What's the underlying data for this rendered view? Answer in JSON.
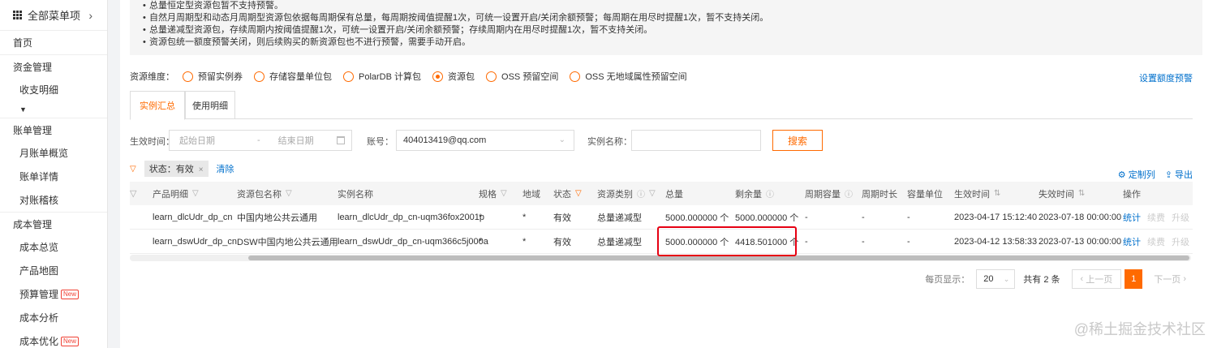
{
  "sidebar": {
    "header": "全部菜单项",
    "items": [
      {
        "label": "首页",
        "type": "top"
      },
      {
        "label": "资金管理",
        "type": "group"
      },
      {
        "label": "收支明细",
        "type": "sub"
      },
      {
        "label": "账单管理",
        "type": "group"
      },
      {
        "label": "月账单概览",
        "type": "sub"
      },
      {
        "label": "账单详情",
        "type": "sub"
      },
      {
        "label": "对账稽核",
        "type": "sub"
      },
      {
        "label": "成本管理",
        "type": "group"
      },
      {
        "label": "成本总览",
        "type": "sub"
      },
      {
        "label": "产品地图",
        "type": "sub"
      },
      {
        "label": "预算管理",
        "type": "sub",
        "badge": "New"
      },
      {
        "label": "成本分析",
        "type": "sub"
      },
      {
        "label": "成本优化",
        "type": "sub",
        "badge": "New"
      }
    ]
  },
  "notice": [
    "总量恒定型资源包暂不支持预警。",
    "自然月周期型和动态月周期型资源包依据每周期保有总量，每周期按阈值提醒1次，可统一设置开启/关闭余额预警；每周期在用尽时提醒1次，暂不支持关闭。",
    "总量递减型资源包，存续周期内按阈值提醒1次，可统一设置开启/关闭余额预警；存续周期内在用尽时提醒1次，暂不支持关闭。",
    "资源包统一额度预警关闭，则后续购买的新资源包也不进行预警，需要手动开启。"
  ],
  "dimension": {
    "label": "资源维度：",
    "options": [
      "预留实例券",
      "存储容量单位包",
      "PolarDB 计算包",
      "资源包",
      "OSS 预留空间",
      "OSS 无地域属性预留空间"
    ],
    "selected": "资源包",
    "right_link": "设置额度预警"
  },
  "tabs": [
    "实例汇总",
    "使用明细"
  ],
  "active_tab": "实例汇总",
  "filters": {
    "effective_label": "生效时间：",
    "start_placeholder": "起始日期",
    "date_sep": "-",
    "end_placeholder": "结束日期",
    "account_label": "账号：",
    "account_value": "404013419@qq.com",
    "instance_label": "实例名称：",
    "instance_value": "",
    "search_label": "搜索"
  },
  "tag_filter": {
    "chip": "状态：有效",
    "clear": "清除",
    "custom_cols": "定制列",
    "export": "导出"
  },
  "table": {
    "columns": [
      "产品明细",
      "资源包名称",
      "实例名称",
      "规格",
      "地域",
      "状态",
      "资源类别",
      "总量",
      "剩余量",
      "周期容量",
      "周期时长",
      "容量单位",
      "生效时间",
      "失效时间",
      "操作"
    ],
    "rows": [
      {
        "product": "learn_dlcUdr_dp_cn",
        "pkg": "中国内地公共云通用",
        "instance": "learn_dlcUdr_dp_cn-uqm36fox2001p",
        "spec": "*",
        "region": "*",
        "status": "有效",
        "category": "总量递减型",
        "total": "5000.000000 个",
        "remain": "5000.000000 个",
        "period_cap": "-",
        "period_len": "-",
        "unit": "-",
        "start": "2023-04-17 15:12:40",
        "end": "2023-07-18 00:00:00",
        "op1": "统计",
        "op2": "续费",
        "op3": "升级"
      },
      {
        "product": "learn_dswUdr_dp_cn",
        "pkg": "DSW中国内地公共云通用",
        "instance": "learn_dswUdr_dp_cn-uqm366c5j000a",
        "spec": "*",
        "region": "*",
        "status": "有效",
        "category": "总量递减型",
        "total": "5000.000000 个",
        "remain": "4418.501000 个",
        "period_cap": "-",
        "period_len": "-",
        "unit": "-",
        "start": "2023-04-12 13:58:33",
        "end": "2023-07-13 00:00:00",
        "op1": "统计",
        "op2": "续费",
        "op3": "升级"
      }
    ]
  },
  "pager": {
    "page_size_label": "每页显示：",
    "page_size": "20",
    "total": "共有 2 条",
    "prev": "上一页",
    "current": "1",
    "next": "下一页"
  },
  "watermark": "@稀土掘金技术社区",
  "colors": {
    "accent": "#ff6a00",
    "link": "#0070cc",
    "highlight": "#e60012"
  }
}
